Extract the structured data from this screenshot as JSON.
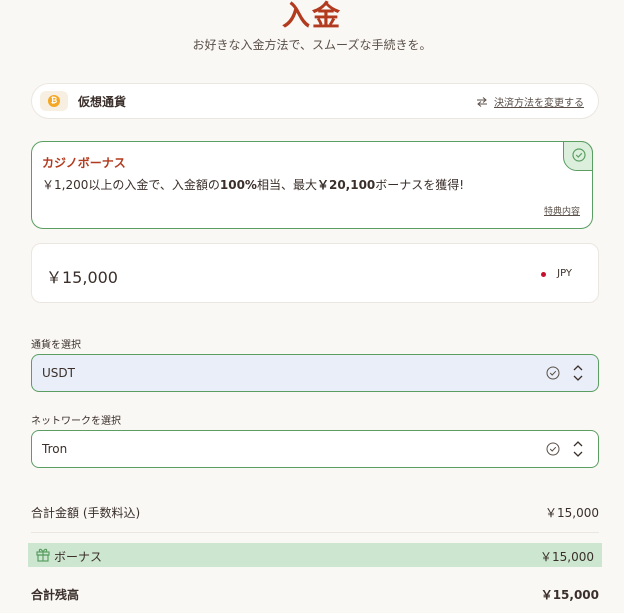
{
  "header": {
    "title": "入金",
    "subtitle": "お好きな入金方法で、スムーズな手続きを。"
  },
  "method": {
    "label": "仮想通貨",
    "change_link": "決済方法を変更する",
    "coin_symbol": "₿"
  },
  "bonus_card": {
    "title": "カジノボーナス",
    "desc_prefix": "￥1,200以上の入金で、入金額の",
    "desc_pct": "100%",
    "desc_mid": "相当、最大",
    "desc_max": "￥20,100",
    "desc_suffix": "ボーナスを獲得!",
    "detail_link": "特典内容"
  },
  "amount": {
    "value": "￥15,000",
    "currency": "JPY"
  },
  "currency_select": {
    "label": "通貨を選択",
    "value": "USDT"
  },
  "network_select": {
    "label": "ネットワークを選択",
    "value": "Tron"
  },
  "summary": {
    "total_label": "合計金額 (手数料込)",
    "total_value": "￥15,000",
    "bonus_label": "ボーナス",
    "bonus_value": "￥15,000",
    "balance_label": "合計残高",
    "balance_value": "￥15,000"
  },
  "colors": {
    "accent": "#b23a1e",
    "success_border": "#5a9e62",
    "bonus_bg": "#cde6cf",
    "select_bg": "#e9eef8"
  }
}
